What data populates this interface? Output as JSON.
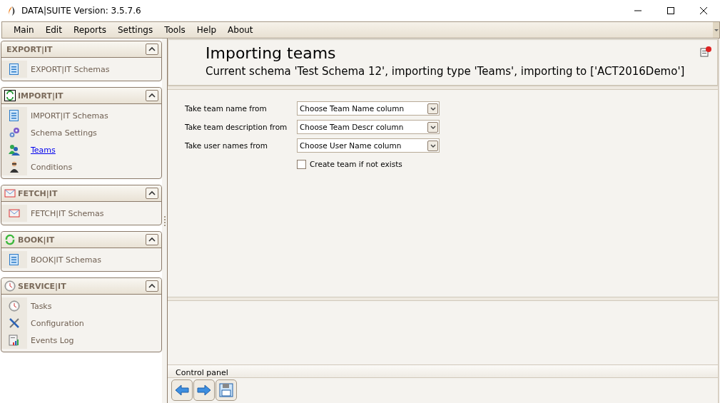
{
  "window": {
    "title": "DATA|SUITE Version: 3.5.7.6"
  },
  "menu": [
    "Main",
    "Edit",
    "Reports",
    "Settings",
    "Tools",
    "Help",
    "About"
  ],
  "sidebar": {
    "sections": [
      {
        "title": "EXPORT|IT",
        "expanded": true,
        "items": [
          {
            "label": "EXPORT|IT Schemas",
            "selected": false
          }
        ]
      },
      {
        "title": "IMPORT|IT",
        "expanded": true,
        "items": [
          {
            "label": "IMPORT|IT Schemas",
            "selected": false
          },
          {
            "label": "Schema Settings",
            "selected": false
          },
          {
            "label": "Teams",
            "selected": true
          },
          {
            "label": "Conditions",
            "selected": false
          }
        ]
      },
      {
        "title": "FETCH|IT",
        "expanded": true,
        "items": [
          {
            "label": "FETCH|IT Schemas",
            "selected": false
          }
        ]
      },
      {
        "title": "BOOK|IT",
        "expanded": true,
        "items": [
          {
            "label": "BOOK|IT Schemas",
            "selected": false
          }
        ]
      },
      {
        "title": "SERVICE|IT",
        "expanded": true,
        "items": [
          {
            "label": "Tasks",
            "selected": false
          },
          {
            "label": "Configuration",
            "selected": false
          },
          {
            "label": "Events Log",
            "selected": false
          }
        ]
      }
    ]
  },
  "header": {
    "title": "Importing teams",
    "subtitle": "Current schema 'Test Schema 12', importing type 'Teams', importing to ['ACT2016Demo']"
  },
  "form": {
    "fields": [
      {
        "label": "Take team name from",
        "value": "Choose Team Name column"
      },
      {
        "label": "Take team description from",
        "value": "Choose Team Descr column"
      },
      {
        "label": "Take user names from",
        "value": "Choose User Name column"
      }
    ],
    "checkbox": {
      "label": "Create team if not exists",
      "checked": false
    }
  },
  "control_panel": {
    "title": "Control panel"
  }
}
